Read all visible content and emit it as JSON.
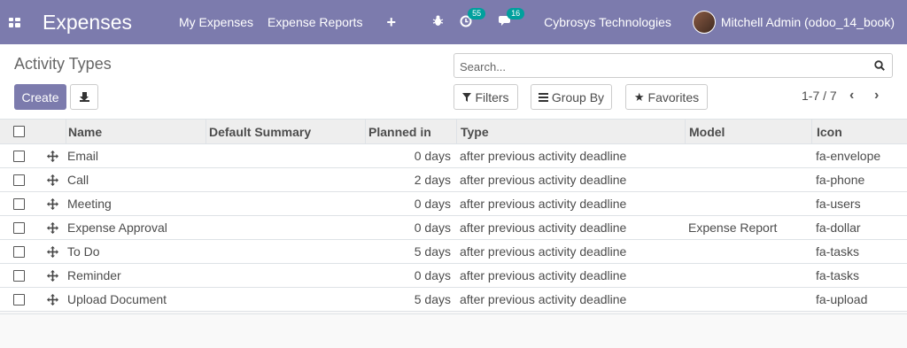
{
  "navbar": {
    "app_title": "Expenses",
    "menu": [
      "My Expenses",
      "Expense Reports"
    ],
    "plus": "+",
    "activity_count": "55",
    "message_count": "16",
    "company": "Cybrosys Technologies",
    "user": "Mitchell Admin (odoo_14_book)"
  },
  "control_panel": {
    "breadcrumb": "Activity Types",
    "create_label": "Create",
    "search_placeholder": "Search...",
    "filters_label": "Filters",
    "groupby_label": "Group By",
    "favorites_label": "Favorites",
    "pager": "1-7 / 7"
  },
  "table": {
    "columns": [
      "Name",
      "Default Summary",
      "Planned in",
      "Type",
      "Model",
      "Icon"
    ],
    "rows": [
      {
        "name": "Email",
        "summary": "",
        "planned": "0 days",
        "type": "after previous activity deadline",
        "model": "",
        "icon": "fa-envelope"
      },
      {
        "name": "Call",
        "summary": "",
        "planned": "2 days",
        "type": "after previous activity deadline",
        "model": "",
        "icon": "fa-phone"
      },
      {
        "name": "Meeting",
        "summary": "",
        "planned": "0 days",
        "type": "after previous activity deadline",
        "model": "",
        "icon": "fa-users"
      },
      {
        "name": "Expense Approval",
        "summary": "",
        "planned": "0 days",
        "type": "after previous activity deadline",
        "model": "Expense Report",
        "icon": "fa-dollar"
      },
      {
        "name": "To Do",
        "summary": "",
        "planned": "5 days",
        "type": "after previous activity deadline",
        "model": "",
        "icon": "fa-tasks"
      },
      {
        "name": "Reminder",
        "summary": "",
        "planned": "0 days",
        "type": "after previous activity deadline",
        "model": "",
        "icon": "fa-tasks"
      },
      {
        "name": "Upload Document",
        "summary": "",
        "planned": "5 days",
        "type": "after previous activity deadline",
        "model": "",
        "icon": "fa-upload"
      }
    ]
  },
  "colors": {
    "brand": "#7c7bad",
    "badge": "#00a09d"
  },
  "icons": [
    "apps-icon",
    "plus-icon",
    "bug-icon",
    "activity-icon",
    "chat-icon",
    "download-icon",
    "search-icon",
    "filter-icon",
    "list-icon",
    "star-icon",
    "chevron-left-icon",
    "chevron-right-icon",
    "drag-handle-icon"
  ]
}
